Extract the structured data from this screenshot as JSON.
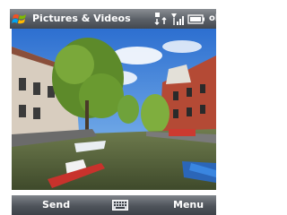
{
  "titlebar": {
    "title": "Pictures & Videos",
    "close_label": "ok",
    "start_icon": "windows-flag-icon",
    "status_icons": [
      "data-connection-icon",
      "signal-strength-icon",
      "battery-icon"
    ]
  },
  "photo": {
    "alt": "Canal street with trees, boats and historic buildings",
    "icon": "photo"
  },
  "softkeys": {
    "left_label": "Send",
    "right_label": "Menu",
    "center_icon": "keyboard-icon"
  },
  "colors": {
    "bar_dark": "#43484f",
    "bar_light": "#8a8e93",
    "text": "#ffffff"
  }
}
